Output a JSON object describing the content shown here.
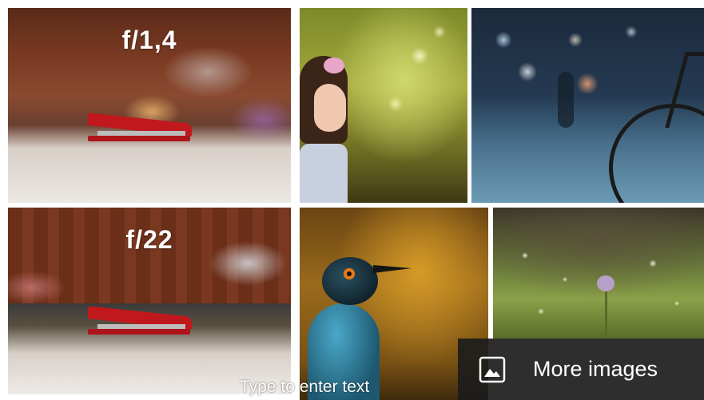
{
  "gallery": {
    "tiles": [
      {
        "label": "f/1,4"
      },
      {
        "label": "f/22"
      }
    ],
    "more_images_label": "More images",
    "placeholder_text": "Type to enter text"
  },
  "icons": {
    "more_images": "image-icon"
  },
  "colors": {
    "overlay": "#1c1c1c",
    "text": "#ffffff"
  }
}
